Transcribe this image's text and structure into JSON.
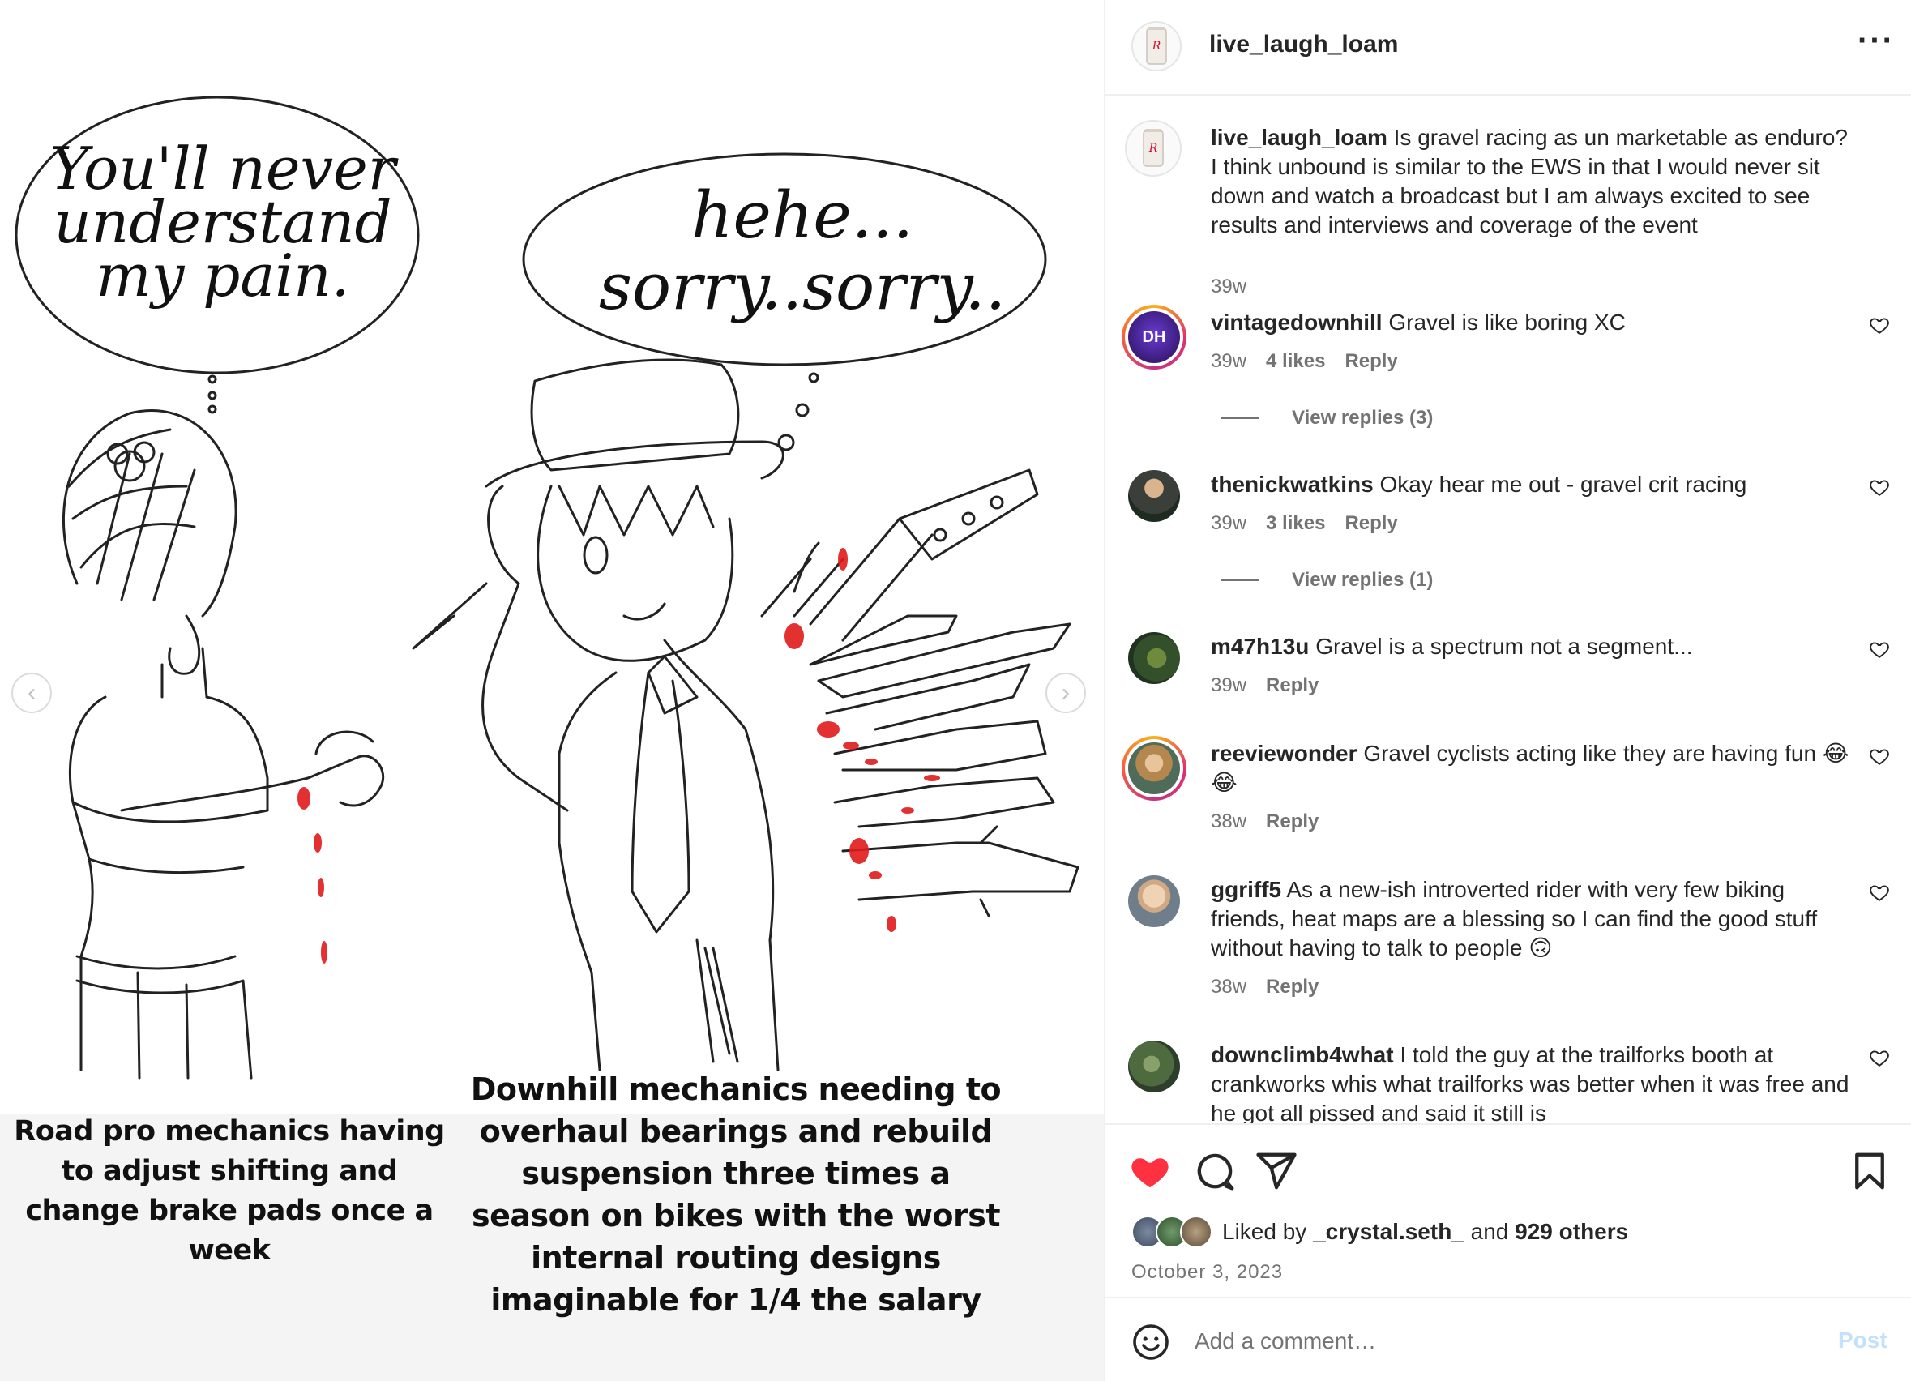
{
  "post": {
    "author": "live_laugh_loam",
    "more_icon": "more-horizontal-icon",
    "media": {
      "left_bubble": "You'll never understand my pain.",
      "right_bubble_line1": "hehe...",
      "right_bubble_line2": "sorry..sorry..",
      "left_caption": "Road pro mechanics having to adjust shifting and change brake pads once a week",
      "right_caption": "Downhill mechanics needing to overhaul bearings and rebuild suspension three times a season on bikes with the worst internal routing designs imaginable for 1/4 the salary",
      "prev_icon": "chevron-left-icon",
      "next_icon": "chevron-right-icon"
    }
  },
  "caption": {
    "user": "live_laugh_loam",
    "text": "Is gravel racing as un marketable as enduro? I think unbound is similar to the EWS in that I would never sit down and watch a broadcast but I am always excited to see results and interviews and coverage of the event",
    "time": "39w"
  },
  "comments": [
    {
      "user": "vintagedownhill",
      "text": "Gravel is like boring XC",
      "time": "39w",
      "likes": "4 likes",
      "reply": "Reply",
      "view_replies": "View replies (3)"
    },
    {
      "user": "thenickwatkins",
      "text": "Okay hear me out - gravel crit racing",
      "time": "39w",
      "likes": "3 likes",
      "reply": "Reply",
      "view_replies": "View replies (1)"
    },
    {
      "user": "m47h13u",
      "text": "Gravel is a spectrum not a segment...",
      "time": "39w",
      "reply": "Reply"
    },
    {
      "user": "reeviewonder",
      "text": "Gravel cyclists acting like they are having fun 😂😂",
      "time": "38w",
      "reply": "Reply"
    },
    {
      "user": "ggriff5",
      "text": "As a new-ish introverted rider with very few biking friends, heat maps are a blessing so I can find the good stuff without having to talk to people 🙃",
      "time": "38w",
      "reply": "Reply"
    },
    {
      "user": "downclimb4what",
      "text": "I told the guy at the trailforks booth at crankworks whis what trailforks was better when it was free and he got all pissed and said it still is"
    }
  ],
  "actions": {
    "like_icon": "heart-filled-icon",
    "comment_icon": "comment-icon",
    "share_icon": "share-icon",
    "save_icon": "bookmark-icon",
    "liked_prefix": "Liked by",
    "liked_user": "_crystal.seth_",
    "liked_and": "and",
    "liked_others": "929 others",
    "date": "October 3, 2023"
  },
  "add_comment": {
    "placeholder": "Add a comment…",
    "post_label": "Post",
    "emoji_icon": "emoji-icon"
  },
  "colors": {
    "like_red": "#ff3040",
    "meta_gray": "#737373",
    "post_disabled": "#c4e1fb",
    "blood": "#e01b1b"
  }
}
